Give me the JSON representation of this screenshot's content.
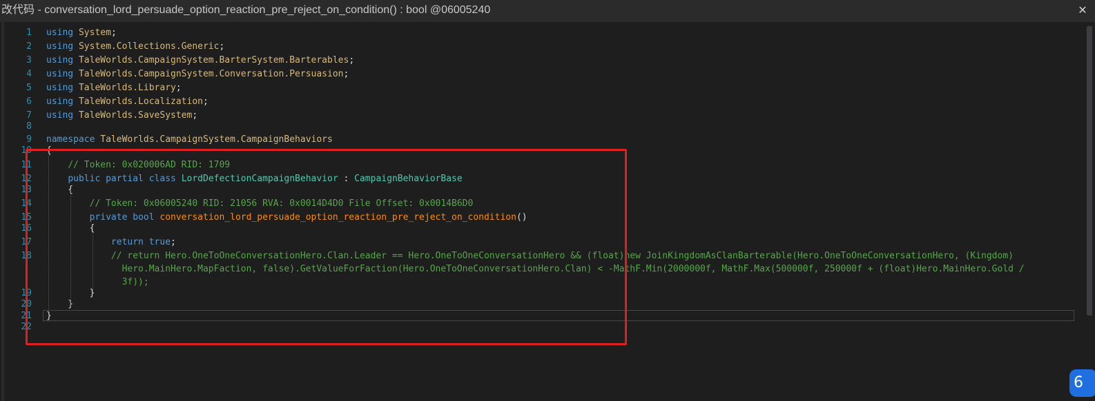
{
  "window": {
    "title": "改代码 - conversation_lord_persuade_option_reaction_pre_reject_on_condition() : bool @06005240",
    "close_glyph": "✕"
  },
  "editor": {
    "lines": [
      {
        "n": "1",
        "segs": [
          [
            "kw",
            "using "
          ],
          [
            "ns",
            "System"
          ],
          [
            "",
            "; "
          ]
        ]
      },
      {
        "n": "2",
        "segs": [
          [
            "kw",
            "using "
          ],
          [
            "ns",
            "System.Collections.Generic"
          ],
          [
            "",
            ";"
          ]
        ]
      },
      {
        "n": "3",
        "segs": [
          [
            "kw",
            "using "
          ],
          [
            "ns",
            "TaleWorlds.CampaignSystem.BarterSystem.Barterables"
          ],
          [
            "",
            ";"
          ]
        ]
      },
      {
        "n": "4",
        "segs": [
          [
            "kw",
            "using "
          ],
          [
            "ns",
            "TaleWorlds.CampaignSystem.Conversation.Persuasion"
          ],
          [
            "",
            ";"
          ]
        ]
      },
      {
        "n": "5",
        "segs": [
          [
            "kw",
            "using "
          ],
          [
            "ns",
            "TaleWorlds.Library"
          ],
          [
            "",
            ";"
          ]
        ]
      },
      {
        "n": "6",
        "segs": [
          [
            "kw",
            "using "
          ],
          [
            "ns",
            "TaleWorlds.Localization"
          ],
          [
            "",
            ";"
          ]
        ]
      },
      {
        "n": "7",
        "segs": [
          [
            "kw",
            "using "
          ],
          [
            "ns",
            "TaleWorlds.SaveSystem"
          ],
          [
            "",
            ";"
          ]
        ]
      },
      {
        "n": "8",
        "segs": []
      },
      {
        "n": "9",
        "segs": [
          [
            "kw",
            "namespace "
          ],
          [
            "ns",
            "TaleWorlds.CampaignSystem.CampaignBehaviors"
          ]
        ]
      },
      {
        "n": "10",
        "segs": [
          [
            "",
            "{"
          ]
        ]
      },
      {
        "n": "11",
        "segs": [
          [
            "",
            "    "
          ],
          [
            "cm",
            "// Token: 0x020006AD RID: 1709"
          ]
        ]
      },
      {
        "n": "12",
        "segs": [
          [
            "",
            "    "
          ],
          [
            "kw",
            "public partial class "
          ],
          [
            "ty",
            "LordDefectionCampaignBehavior"
          ],
          [
            "",
            " : "
          ],
          [
            "ty",
            "CampaignBehaviorBase"
          ]
        ]
      },
      {
        "n": "13",
        "segs": [
          [
            "",
            "    {"
          ]
        ]
      },
      {
        "n": "14",
        "segs": [
          [
            "",
            "        "
          ],
          [
            "cm",
            "// Token: 0x06005240 RID: 21056 RVA: 0x0014D4D0 File Offset: 0x0014B6D0"
          ]
        ]
      },
      {
        "n": "15",
        "segs": [
          [
            "",
            "        "
          ],
          [
            "kw",
            "private bool "
          ],
          [
            "fn",
            "conversation_lord_persuade_option_reaction_pre_reject_on_condition"
          ],
          [
            "",
            "()"
          ]
        ]
      },
      {
        "n": "16",
        "segs": [
          [
            "",
            "        {"
          ]
        ]
      },
      {
        "n": "17",
        "segs": [
          [
            "",
            "            "
          ],
          [
            "kw",
            "return true"
          ],
          [
            "",
            ";"
          ]
        ]
      },
      {
        "n": "18",
        "segs": [
          [
            "",
            "            "
          ],
          [
            "cm",
            "// return Hero.OneToOneConversationHero.Clan.Leader == Hero.OneToOneConversationHero && (float)new JoinKingdomAsClanBarterable(Hero.OneToOneConversationHero, (Kingdom)"
          ]
        ]
      },
      {
        "n": "",
        "segs": [
          [
            "",
            "              "
          ],
          [
            "cm",
            "Hero.MainHero.MapFaction, false).GetValueForFaction(Hero.OneToOneConversationHero.Clan) < -MathF.Min(2000000f, MathF.Max(500000f, 250000f + (float)Hero.MainHero.Gold /"
          ]
        ]
      },
      {
        "n": "",
        "segs": [
          [
            "",
            "              "
          ],
          [
            "cm",
            "3f));"
          ]
        ]
      },
      {
        "n": "19",
        "segs": [
          [
            "",
            "        }"
          ]
        ]
      },
      {
        "n": "20",
        "segs": [
          [
            "",
            "    }"
          ]
        ]
      },
      {
        "n": "21",
        "segs": [
          [
            "",
            "}"
          ]
        ]
      },
      {
        "n": "22",
        "segs": []
      }
    ]
  },
  "widget": {
    "glyph": "6"
  }
}
